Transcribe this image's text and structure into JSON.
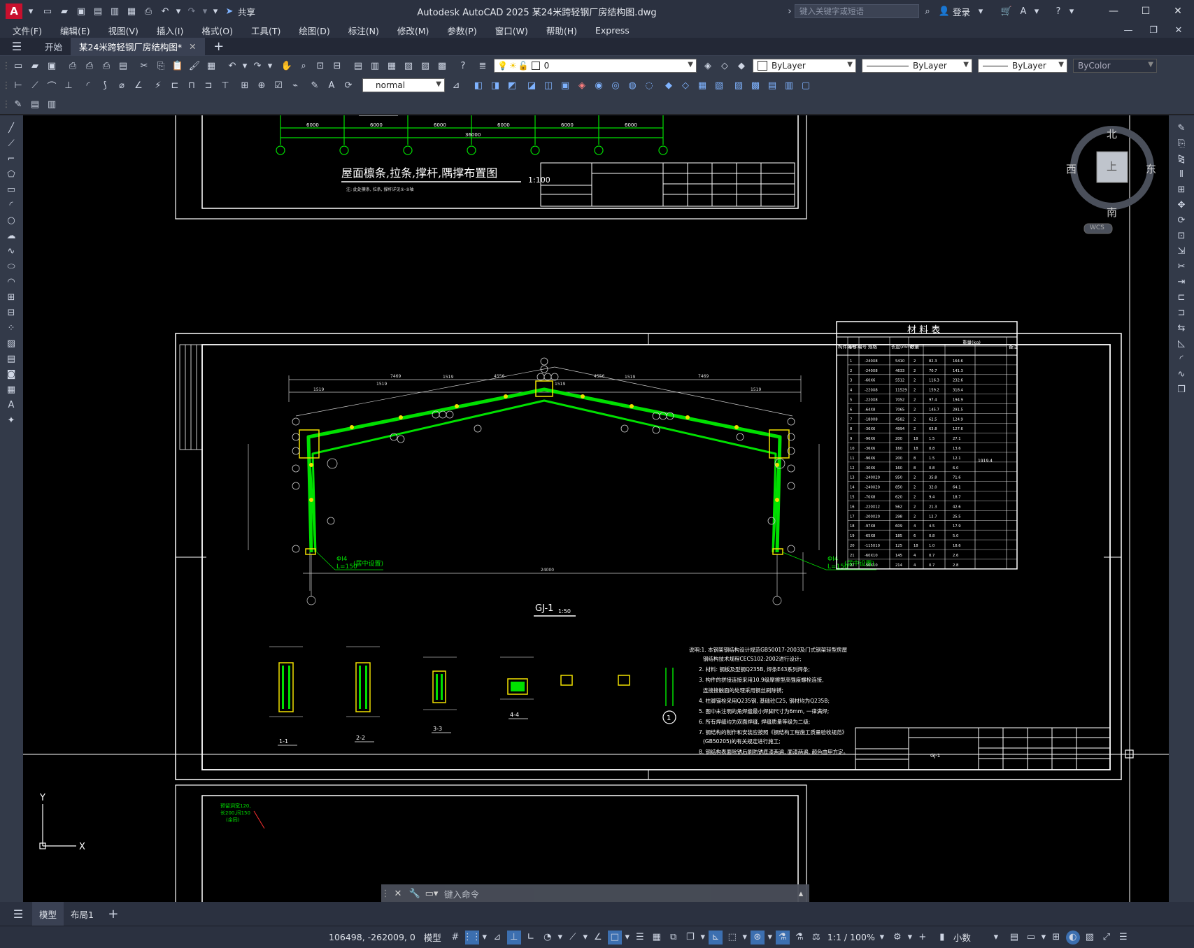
{
  "app": {
    "title": "Autodesk AutoCAD 2025    某24米跨轻钢厂房结构图.dwg",
    "share_label": "共享",
    "search_placeholder": "键入关键字或短语",
    "login_label": "登录",
    "logo_letter": "A"
  },
  "menu": [
    "文件(F)",
    "编辑(E)",
    "视图(V)",
    "插入(I)",
    "格式(O)",
    "工具(T)",
    "绘图(D)",
    "标注(N)",
    "修改(M)",
    "参数(P)",
    "窗口(W)",
    "帮助(H)",
    "Express"
  ],
  "tabs": {
    "start": "开始",
    "doc": "某24米跨轻钢厂房结构图*"
  },
  "toolbar": {
    "layer_value": "0",
    "color_value": "ByLayer",
    "linetype_value": "ByLayer",
    "lineweight_value": "ByLayer",
    "plotstyle_value": "ByColor",
    "dimstyle_value": "normal"
  },
  "viewcube": {
    "north": "北",
    "south": "南",
    "west": "西",
    "east": "东",
    "top": "上",
    "wcs": "WCS"
  },
  "ucs": {
    "y": "Y",
    "x": "X"
  },
  "drawing": {
    "sheet1_title": "屋面檩条,拉条,撑杆,隅撑布置图",
    "sheet1_scale": "1:100",
    "sheet1_subnote": "注: 此处檩条, 拉条, 撑杆详见①-②轴",
    "dims_top": [
      "6000",
      "6000",
      "6000",
      "6000",
      "6000",
      "6000"
    ],
    "dim_total": "36000",
    "axis_marks": [
      "⑦",
      "⑥",
      "⑤",
      "④",
      "③",
      "②",
      "①"
    ],
    "frame_title": "GJ-1",
    "frame_scale": "1:50",
    "span_dim": "24000",
    "anchor_label_left": "ΦI4",
    "anchor_len_left": "L=150",
    "anchor_note_left": "(居中设置)",
    "anchor_label_right": "ΦI4",
    "anchor_len_right": "L=150",
    "anchor_note_right": "(居中设置)",
    "material_table_title": "材 料 表",
    "material_headers": [
      "构件编号",
      "零件编号",
      "规格",
      "长度(mm)",
      "数量",
      "重量(kg)",
      "备注"
    ],
    "material_total": "1919.4",
    "material_rows": [
      [
        "1",
        "-240X8",
        "5410",
        "2",
        "82.3",
        "164.6"
      ],
      [
        "2",
        "-240X8",
        "4633",
        "2",
        "70.7",
        "141.3"
      ],
      [
        "3",
        "-60X6",
        "5512",
        "2",
        "116.3",
        "232.6"
      ],
      [
        "4",
        "-220X8",
        "11529",
        "2",
        "159.2",
        "318.4"
      ],
      [
        "5",
        "-220X8",
        "7052",
        "2",
        "97.4",
        "194.9"
      ],
      [
        "6",
        "-64X8",
        "7065",
        "2",
        "145.7",
        "291.5"
      ],
      [
        "7",
        "-180X8",
        "4582",
        "2",
        "62.5",
        "124.9"
      ],
      [
        "8",
        "-36X6",
        "4994",
        "2",
        "63.8",
        "127.6"
      ],
      [
        "9",
        "-96X6",
        "200",
        "18",
        "1.5",
        "27.1"
      ],
      [
        "10",
        "-36X6",
        "160",
        "18",
        "0.8",
        "13.6"
      ],
      [
        "11",
        "-96X6",
        "200",
        "8",
        "1.5",
        "12.1"
      ],
      [
        "12",
        "-30X6",
        "160",
        "8",
        "0.8",
        "6.0"
      ],
      [
        "13",
        "-240X20",
        "950",
        "2",
        "35.8",
        "71.6"
      ],
      [
        "14",
        "-240X20",
        "850",
        "2",
        "32.0",
        "64.1"
      ],
      [
        "15",
        "-70X8",
        "620",
        "2",
        "9.4",
        "18.7"
      ],
      [
        "16",
        "-220X12",
        "562",
        "2",
        "21.3",
        "42.6"
      ],
      [
        "17",
        "-200X20",
        "298",
        "2",
        "12.7",
        "25.5"
      ],
      [
        "18",
        "-97X8",
        "609",
        "4",
        "4.5",
        "17.9"
      ],
      [
        "19",
        "-65X8",
        "185",
        "6",
        "0.8",
        "5.0"
      ],
      [
        "20",
        "-115X10",
        "125",
        "18",
        "1.0",
        "18.6"
      ],
      [
        "21",
        "-60X10",
        "145",
        "4",
        "0.7",
        "2.6"
      ],
      [
        "22",
        "-50X10",
        "214",
        "4",
        "0.7",
        "2.8"
      ]
    ],
    "section_labels": [
      "1-1",
      "2-2",
      "3-3",
      "4-4"
    ],
    "detail_mark": "1",
    "notes": [
      "说明:1. 本钢架钢结构设计规范GB50017-2003及门式钢架轻型房屋",
      "钢结构技术规程CECS102:2002进行设计;",
      "2. 材料: 钢板及型钢Q235B, 焊条E43系列焊条;",
      "3. 构件的拼接连接采用10.9级摩擦型高强度螺栓连接,",
      "连接接触面的处理采用钢丝刷除锈;",
      "4. 柱脚锚栓采用Q235钢, 基础砼C25, 钢材均为Q235B;",
      "5. 图中未注明的角焊缝最小焊脚尺寸为6mm, 一律满焊;",
      "6. 所有焊缝均为双面焊缝, 焊缝质量等级为二级;",
      "7. 钢结构的制作和安装应按照《钢结构工程施工质量验收规范》",
      "(GB50205)的有关规定进行施工;",
      "8. 钢结构表面除锈后刷防锈底漆两遍, 面漆两遍, 颜色由甲方定。"
    ],
    "titleblock_code": "GJ-1",
    "sheet3_note_a": "预留洞宽120,",
    "sheet3_note_b": "长200,间150",
    "sheet3_note_c": "(余同)"
  },
  "command_placeholder": "键入命令",
  "layout_tabs": {
    "model": "模型",
    "layout1": "布局1"
  },
  "status": {
    "coords": "106498, -262009, 0",
    "mode": "模型",
    "scale": "1:1 / 100%",
    "units": "小数"
  }
}
